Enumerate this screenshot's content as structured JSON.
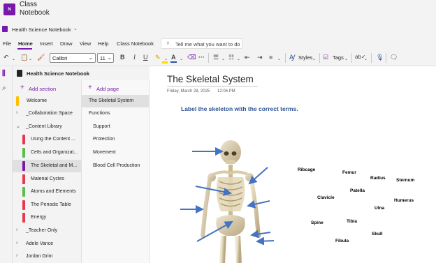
{
  "app": {
    "name": "Class Notebook",
    "icon": "class-notebook-icon",
    "brand_color": "#7719aa"
  },
  "notebook_bar": {
    "name": "Health Science Notebook",
    "icon": "notebook-icon"
  },
  "menu": {
    "items": [
      "File",
      "Home",
      "Insert",
      "Draw",
      "View",
      "Help",
      "Class Notebook"
    ],
    "active": "Home",
    "tell_me": {
      "placeholder": "Tell me what you want to do",
      "icon": "lightbulb-icon"
    }
  },
  "ribbon": {
    "font_name": "Calibri",
    "font_size": "11",
    "bold": "B",
    "italic": "I",
    "underline": "U",
    "more": "···",
    "styles_label": "Styles",
    "tags_label": "Tags",
    "icons": [
      "undo-icon",
      "paste-icon",
      "format-painter-icon",
      "highlight-icon",
      "font-color-icon",
      "bullets-icon",
      "numbering-icon",
      "outdent-icon",
      "indent-icon",
      "align-icon",
      "styles-icon",
      "tags-icon",
      "spelling-icon",
      "dictate-icon",
      "sticky-note-icon"
    ]
  },
  "sidebar": {
    "notebook_title": "Health Science Notebook",
    "add_section": "Add section",
    "add_page": "Add page",
    "sections": [
      {
        "type": "section",
        "label": "Welcome",
        "color": "#ffc000",
        "selected": false
      },
      {
        "type": "group",
        "label": "_Collaboration Space",
        "expanded": false
      },
      {
        "type": "group",
        "label": "_Content Library",
        "expanded": true
      },
      {
        "type": "section",
        "label": "Using the Content ...",
        "color": "#e8384f",
        "selected": false
      },
      {
        "type": "section",
        "label": "Cells and Organizat...",
        "color": "#5bbd4a",
        "selected": false
      },
      {
        "type": "section",
        "label": "The Skeletal and M...",
        "color": "#7719aa",
        "selected": true
      },
      {
        "type": "section",
        "label": "Material Cycles",
        "color": "#e8384f",
        "selected": false
      },
      {
        "type": "section",
        "label": "Atoms and Elements",
        "color": "#5bbd4a",
        "selected": false
      },
      {
        "type": "section",
        "label": "The Periodic Table",
        "color": "#e8384f",
        "selected": false
      },
      {
        "type": "section",
        "label": "Energy",
        "color": "#e8384f",
        "selected": false
      },
      {
        "type": "group",
        "label": "_Teacher Only",
        "expanded": false
      },
      {
        "type": "group",
        "label": "Adele Vance",
        "expanded": false
      },
      {
        "type": "group",
        "label": "Jordan Grim",
        "expanded": false
      }
    ],
    "pages": [
      {
        "label": "The Skeletal System",
        "level": 0,
        "selected": true
      },
      {
        "label": "Functions",
        "level": 0,
        "selected": false
      },
      {
        "label": "Support",
        "level": 1,
        "selected": false
      },
      {
        "label": "Protection",
        "level": 1,
        "selected": false
      },
      {
        "label": "Movement",
        "level": 1,
        "selected": false
      },
      {
        "label": "Blood Cell Production",
        "level": 1,
        "selected": false
      }
    ]
  },
  "canvas": {
    "title": "The Skeletal System",
    "date": "Friday, March 28, 2025",
    "time": "12:06 PM",
    "instruction": "Label the skeleton with the correct terms.",
    "terms": [
      "Ribcage",
      "Femur",
      "Radius",
      "Sternum",
      "Patella",
      "Clavicle",
      "Humerus",
      "Ulna",
      "Spine",
      "Tibia",
      "Skull",
      "Fibula"
    ]
  }
}
